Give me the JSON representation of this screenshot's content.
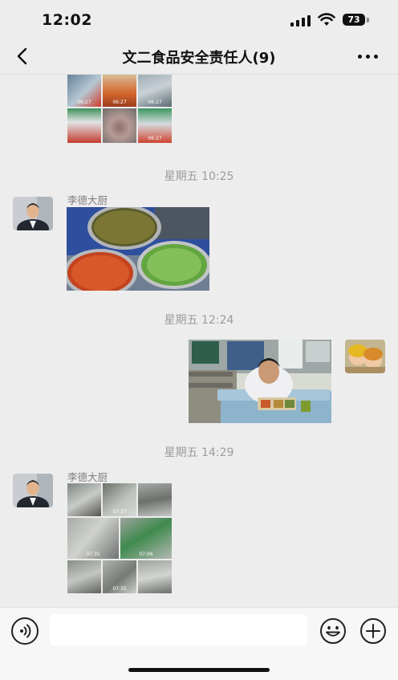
{
  "status": {
    "time": "12:02",
    "battery": "73"
  },
  "nav": {
    "title": "文二食品安全责任人(9)"
  },
  "chat": {
    "top_grid": {
      "labels": [
        "06:27",
        "06:27",
        "06:27",
        "",
        "",
        "06:27",
        "",
        "",
        ""
      ]
    },
    "ts1": "星期五 10:25",
    "msg1": {
      "sender": "李德大厨"
    },
    "ts2": "星期五 12:24",
    "ts3": "星期五 14:29",
    "msg3": {
      "sender": "李德大厨",
      "labels": [
        "",
        "07:37",
        "",
        "07:35",
        "",
        "07:06",
        "",
        "07:35",
        ""
      ]
    }
  },
  "input": {
    "placeholder": ""
  },
  "colors": {
    "background": "#ededed",
    "timestamp": "#9b9b9b",
    "sender": "#808080"
  }
}
